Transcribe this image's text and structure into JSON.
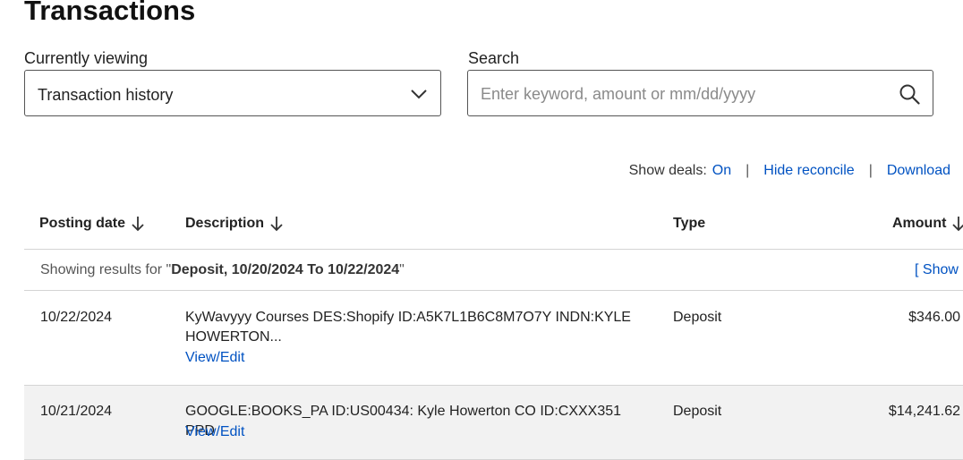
{
  "page": {
    "title": "Transactions"
  },
  "viewing": {
    "label": "Currently viewing",
    "value": "Transaction history"
  },
  "search": {
    "label": "Search",
    "placeholder": "Enter keyword, amount or mm/dd/yyyy"
  },
  "toolbar": {
    "show_deals_label": "Show deals:",
    "show_deals_value": "On",
    "separator": "|",
    "hide_reconcile": "Hide reconcile",
    "download": "Download"
  },
  "table": {
    "columns": {
      "posting_date": "Posting date",
      "description": "Description",
      "type": "Type",
      "amount": "Amount"
    },
    "filter": {
      "prefix": "Showing results for \"",
      "query": "Deposit, 10/20/2024 To 10/22/2024",
      "suffix": "\"",
      "show_all": "[ Show a"
    },
    "rows": [
      {
        "date": "10/22/2024",
        "description": "KyWavyyy Courses DES:Shopify ID:A5K7L1B6C8M7O7Y INDN:KYLE HOWERTON...",
        "link": "View/Edit",
        "type": "Deposit",
        "amount": "$346.00"
      },
      {
        "date": "10/21/2024",
        "description": "GOOGLE:BOOKS_PA ID:US00434: Kyle Howerton CO ID:CXXX351 PPD",
        "link": "View/Edit",
        "type": "Deposit",
        "amount": "$14,241.62"
      }
    ]
  },
  "icons": {
    "dropdown": "chevron-down-icon",
    "search": "search-icon",
    "sort": "arrow-down-icon"
  },
  "colors": {
    "link": "#0052c2",
    "row_alt_bg": "#f2f2f2",
    "divider": "#d4d4d4"
  }
}
